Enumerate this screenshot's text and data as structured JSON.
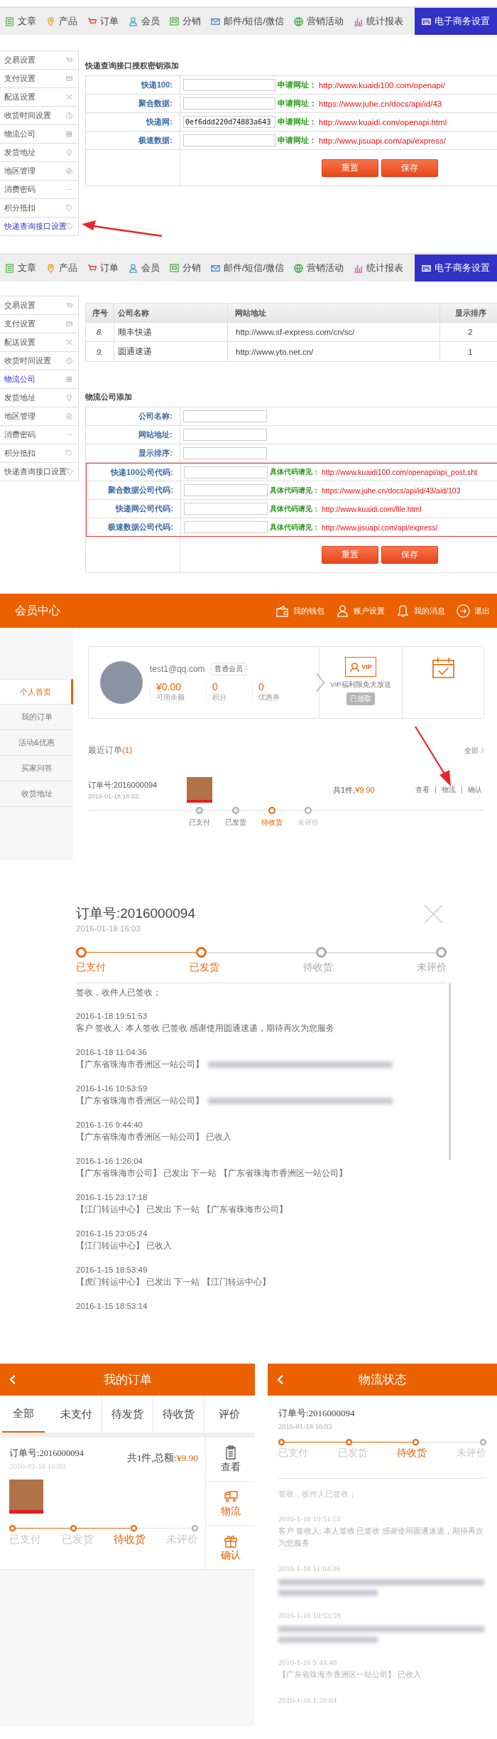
{
  "admin_api_view": {
    "nav": [
      {
        "label": "文章",
        "selected": false
      },
      {
        "label": "产品",
        "selected": false
      },
      {
        "label": "订单",
        "selected": false
      },
      {
        "label": "会员",
        "selected": false
      },
      {
        "label": "分销",
        "selected": false
      },
      {
        "label": "邮件/短信/微信",
        "selected": false
      },
      {
        "label": "营销活动",
        "selected": false
      },
      {
        "label": "统计报表",
        "selected": false
      },
      {
        "label": "电子商务设置",
        "selected": true
      }
    ],
    "sidebar": [
      {
        "label": "交易设置",
        "selected": false
      },
      {
        "label": "支付设置",
        "selected": false
      },
      {
        "label": "配送设置",
        "selected": false
      },
      {
        "label": "收货时间设置",
        "selected": false
      },
      {
        "label": "物流公司",
        "selected": false
      },
      {
        "label": "发货地址",
        "selected": false
      },
      {
        "label": "地区管理",
        "selected": false
      },
      {
        "label": "消费密码",
        "selected": false
      },
      {
        "label": "积分抵扣",
        "selected": false
      },
      {
        "label": "快递查询接口设置",
        "selected": true
      }
    ],
    "form": {
      "title": "快递查询接口授权密钥添加",
      "rows": [
        {
          "label": "快递100:",
          "hint": "申请网址：",
          "url": "http://www.kuaidi100.com/openapi/"
        },
        {
          "label": "聚合数据:",
          "hint": "申请网址：",
          "url": "https://www.juhe.cn/docs/api/id/43"
        },
        {
          "label": "快递网:",
          "value": "0ef6ddd220d74883a643",
          "hint": "申请网址：",
          "url": "http://www.kuaidi.com/openapi.html"
        },
        {
          "label": "极速数据:",
          "hint": "申请网址：",
          "url": "http://www.jisuapi.com/api/express/"
        }
      ],
      "buttons": [
        "重置",
        "保存"
      ]
    }
  },
  "admin_logistics_view": {
    "nav": [
      {
        "label": "文章",
        "selected": false
      },
      {
        "label": "产品",
        "selected": false
      },
      {
        "label": "订单",
        "selected": false
      },
      {
        "label": "会员",
        "selected": false
      },
      {
        "label": "分销",
        "selected": false
      },
      {
        "label": "邮件/短信/微信",
        "selected": false
      },
      {
        "label": "营销活动",
        "selected": false
      },
      {
        "label": "统计报表",
        "selected": false
      },
      {
        "label": "电子商务设置",
        "selected": true
      }
    ],
    "sidebar": [
      {
        "label": "交易设置",
        "selected": false
      },
      {
        "label": "支付设置",
        "selected": false
      },
      {
        "label": "配送设置",
        "selected": false
      },
      {
        "label": "收货时间设置",
        "selected": false
      },
      {
        "label": "物流公司",
        "selected": true
      },
      {
        "label": "发货地址",
        "selected": false
      },
      {
        "label": "地区管理",
        "selected": false
      },
      {
        "label": "消费密码",
        "selected": false
      },
      {
        "label": "积分抵扣",
        "selected": false
      },
      {
        "label": "快递查询接口设置",
        "selected": false
      }
    ],
    "table": {
      "columns": [
        "序号",
        "公司名称",
        "网站地址",
        "显示排序"
      ],
      "rows": [
        [
          "8.",
          "顺丰快递",
          "http://www.sf-express.com/cn/sc/",
          "2"
        ],
        [
          "9.",
          "圆通速递",
          "http://www.yto.net.cn/",
          "1"
        ]
      ]
    },
    "form": {
      "title": "物流公司添加",
      "rows": [
        {
          "label": "公司名称:",
          "highlighted": false
        },
        {
          "label": "网站地址:",
          "highlighted": false
        },
        {
          "label": "显示排序:",
          "highlighted": false
        },
        {
          "label": "快递100公司代码:",
          "hint": "具体代码请见：",
          "url": "http://www.kuaidi100.com/openapi/api_post.sht",
          "highlighted": true
        },
        {
          "label": "聚合数据公司代码:",
          "hint": "具体代码请见：",
          "url": "https://www.juhe.cn/docs/api/id/43/aid/103",
          "highlighted": true
        },
        {
          "label": "快递网公司代码:",
          "hint": "具体代码请见：",
          "url": "http://www.kuaidi.com/file.html",
          "highlighted": true
        },
        {
          "label": "极速数据公司代码:",
          "hint": "具体代码请见：",
          "url": "http://www.jisuapi.com/api/express/",
          "highlighted": true
        }
      ],
      "buttons": [
        "重置",
        "保存"
      ]
    }
  },
  "member_center": {
    "title": "会员中心",
    "header_links": [
      "我的钱包",
      "账户设置",
      "我的消息",
      "退出"
    ],
    "sidebar": [
      {
        "label": "个人首页",
        "selected": true
      },
      {
        "label": "我的订单",
        "selected": false
      },
      {
        "label": "活动&优惠",
        "selected": false
      },
      {
        "label": "买家问答",
        "selected": false
      },
      {
        "label": "收货地址",
        "selected": false
      }
    ],
    "profile": {
      "email": "test1@qq.com",
      "badge": "普通会员",
      "stats": [
        {
          "value": "¥0.00",
          "label": "可用余额"
        },
        {
          "value": "0",
          "label": "积分"
        },
        {
          "value": "0",
          "label": "优惠券"
        }
      ]
    },
    "vip": {
      "icon_text": "VIP",
      "text": "VIP福利限免大放送",
      "button": "已领取"
    },
    "recent_orders": {
      "title": "最近订单",
      "count": "(1)",
      "all_link": "全部"
    },
    "order": {
      "number": "订单号:2016000094",
      "date": "2016-01-18 16:03",
      "quantity": "共1件,",
      "amount": "¥9.90",
      "actions": [
        "查看",
        "物流",
        "确认"
      ],
      "steps": [
        {
          "label": "已支付",
          "done": true,
          "current": false
        },
        {
          "label": "已发货",
          "done": true,
          "current": false
        },
        {
          "label": "待收货",
          "done": false,
          "current": true
        },
        {
          "label": "未评价",
          "done": false,
          "current": false
        }
      ]
    }
  },
  "order_modal": {
    "order_number": "订单号:2016000094",
    "date": "2016-01-18 16:03",
    "steps": [
      {
        "label": "已支付",
        "done": true,
        "current": false
      },
      {
        "label": "已发货",
        "done": true,
        "current": false
      },
      {
        "label": "待收货",
        "done": false,
        "current": false
      },
      {
        "label": "未评价",
        "done": false,
        "current": false
      }
    ],
    "summary": "签收，收件人已签收；",
    "events": [
      {
        "time": "2016-1-18 19:51:53",
        "text": "客户 签收人: 本人签收 已签收 感谢使用圆通速递，期待再次为您服务",
        "redacted": false
      },
      {
        "time": "2016-1-18 11:04:36",
        "text": "【广东省珠海市香洲区一站公司】",
        "redacted": true
      },
      {
        "time": "2016-1-16 10:53:59",
        "text": "【广东省珠海市香洲区一站公司】",
        "redacted": true
      },
      {
        "time": "2016-1-16 9:44:40",
        "text": "【广东省珠海市香洲区一站公司】 已收入",
        "redacted": false
      },
      {
        "time": "2016-1-16 1:26:04",
        "text": "【广东省珠海市公司】 已发出 下一站 【广东省珠海市香洲区一站公司】",
        "redacted": false
      },
      {
        "time": "2016-1-15 23:17:18",
        "text": "【江门转运中心】 已发出 下一站 【广东省珠海市公司】",
        "redacted": false
      },
      {
        "time": "2016-1-15 23:05:24",
        "text": "【江门转运中心】 已收入",
        "redacted": false
      },
      {
        "time": "2016-1-15 18:53:49",
        "text": "【虎门转运中心】 已发出 下一站 【江门转运中心】",
        "redacted": false
      },
      {
        "time": "2016-1-15 18:53:14",
        "redacted": false
      }
    ]
  },
  "mobile_orders": {
    "title": "我的订单",
    "tabs": [
      {
        "label": "全部",
        "selected": true
      },
      {
        "label": "未支付",
        "selected": false
      },
      {
        "label": "待发货",
        "selected": false
      },
      {
        "label": "待收货",
        "selected": false
      },
      {
        "label": "评价",
        "selected": false
      }
    ],
    "order": {
      "number": "订单号:2016000094",
      "date": "2016-01-18 16:03",
      "total_label": "共1件,总额:",
      "amount": "¥9.90",
      "steps": [
        {
          "label": "已支付",
          "done": true,
          "current": false
        },
        {
          "label": "已发货",
          "done": true,
          "current": false
        },
        {
          "label": "待收货",
          "done": false,
          "current": true
        },
        {
          "label": "未评价",
          "done": false,
          "current": false
        }
      ],
      "actions": [
        {
          "label": "查看",
          "accent": false
        },
        {
          "label": "物流",
          "accent": true
        },
        {
          "label": "确认",
          "accent": true
        }
      ]
    }
  },
  "mobile_logistics": {
    "title": "物流状态",
    "order_number": "订单号:2016000094",
    "date": "2016-01-18 16:03",
    "steps": [
      {
        "label": "已支付",
        "done": true,
        "current": false
      },
      {
        "label": "已发货",
        "done": true,
        "current": false
      },
      {
        "label": "待收货",
        "done": false,
        "current": true
      },
      {
        "label": "未评价",
        "done": false,
        "current": false
      }
    ],
    "summary": "签收，收件人已签收；",
    "events": [
      {
        "time": "2016-1-18 19:51:53",
        "text": "客户 签收人: 本人签收 已签收 感谢使用圆通速递，期待再次为您服务",
        "redacted": false
      },
      {
        "time": "2016-1-18 11:04:36",
        "redacted": true
      },
      {
        "time": "2016-1-16 10:53:59",
        "redacted": true
      },
      {
        "time": "2016-1-16 9:44:40",
        "text": "【广东省珠海市香洲区一站公司】 已收入",
        "redacted": false
      },
      {
        "time": "2016-1-16 1:26:04",
        "redacted": false
      }
    ]
  }
}
